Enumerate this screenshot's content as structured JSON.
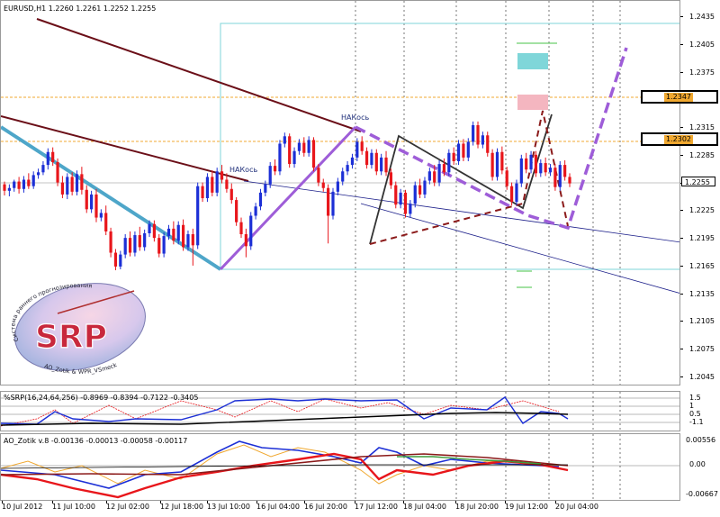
{
  "colors": {
    "bull": "#1c2fd6",
    "bear": "#e8161b",
    "purple": "#9e5dd8",
    "maroon": "#6b0f18",
    "teal": "#4ea6c9",
    "navy": "#1c1f8a",
    "cyan_box": "#7fd6d9",
    "orange_level": "#f0a830"
  },
  "main_chart": {
    "title": "EURUSD,H1  1.2260 1.2261 1.2252 1.2255",
    "price_labels": [
      "1.2435",
      "1.2405",
      "1.2375",
      "1.2345",
      "1.2315",
      "1.2285",
      "1.2255",
      "1.2225",
      "1.2195",
      "1.2165",
      "1.2135",
      "1.2105",
      "1.2075",
      "1.2045"
    ],
    "current_price": "1.2255",
    "level_tags": [
      "1.2347",
      "1.2302"
    ],
    "annotations": [
      "НАКось",
      "НАКось"
    ],
    "logo": {
      "text": "SRP",
      "arc_top": "Система раннего прогнозирования",
      "arc_bottom": "AO_Zotik & WPR_VSmeck"
    },
    "candles": [
      [
        1.2254,
        1.2247,
        1.2257,
        1.2242
      ],
      [
        1.2247,
        1.225,
        1.2254,
        1.2241
      ],
      [
        1.225,
        1.2257,
        1.2259,
        1.2246
      ],
      [
        1.2257,
        1.2249,
        1.2262,
        1.2244
      ],
      [
        1.2249,
        1.2259,
        1.2263,
        1.2245
      ],
      [
        1.2259,
        1.2252,
        1.2266,
        1.2249
      ],
      [
        1.2252,
        1.2264,
        1.2268,
        1.2249
      ],
      [
        1.2264,
        1.2267,
        1.2271,
        1.226
      ],
      [
        1.2267,
        1.2275,
        1.2279,
        1.2264
      ],
      [
        1.2275,
        1.2289,
        1.2293,
        1.227
      ],
      [
        1.2289,
        1.2278,
        1.2294,
        1.2274
      ],
      [
        1.2278,
        1.2256,
        1.2282,
        1.2252
      ],
      [
        1.2256,
        1.2243,
        1.2263,
        1.2239
      ],
      [
        1.2243,
        1.2262,
        1.2266,
        1.2238
      ],
      [
        1.2262,
        1.2246,
        1.2267,
        1.2242
      ],
      [
        1.2246,
        1.2265,
        1.2269,
        1.2242
      ],
      [
        1.2265,
        1.2248,
        1.2273,
        1.2243
      ],
      [
        1.2248,
        1.2227,
        1.2253,
        1.2223
      ],
      [
        1.2227,
        1.2243,
        1.2247,
        1.2223
      ],
      [
        1.2243,
        1.2218,
        1.2249,
        1.2213
      ],
      [
        1.2218,
        1.2223,
        1.2227,
        1.2214
      ],
      [
        1.2223,
        1.2203,
        1.2231,
        1.2199
      ],
      [
        1.2203,
        1.218,
        1.2207,
        1.2175
      ],
      [
        1.218,
        1.2165,
        1.2184,
        1.2161
      ],
      [
        1.2165,
        1.2178,
        1.2182,
        1.2162
      ],
      [
        1.2178,
        1.2196,
        1.22,
        1.2174
      ],
      [
        1.2196,
        1.218,
        1.2203,
        1.2176
      ],
      [
        1.218,
        1.2199,
        1.2203,
        1.2176
      ],
      [
        1.2199,
        1.2186,
        1.2208,
        1.2182
      ],
      [
        1.2186,
        1.2201,
        1.2205,
        1.2182
      ],
      [
        1.2201,
        1.2211,
        1.2215,
        1.2197
      ],
      [
        1.2211,
        1.2196,
        1.2215,
        1.2192
      ],
      [
        1.2196,
        1.2179,
        1.22,
        1.2175
      ],
      [
        1.2179,
        1.2198,
        1.2202,
        1.2175
      ],
      [
        1.2198,
        1.2206,
        1.221,
        1.2194
      ],
      [
        1.2206,
        1.2193,
        1.2214,
        1.2189
      ],
      [
        1.2193,
        1.221,
        1.2214,
        1.2189
      ],
      [
        1.221,
        1.2186,
        1.2216,
        1.2182
      ],
      [
        1.2186,
        1.22,
        1.2204,
        1.2182
      ],
      [
        1.22,
        1.2188,
        1.2206,
        1.2166
      ],
      [
        1.2188,
        1.2252,
        1.2256,
        1.2184
      ],
      [
        1.2252,
        1.2239,
        1.2256,
        1.2235
      ],
      [
        1.2239,
        1.2262,
        1.2266,
        1.2235
      ],
      [
        1.2262,
        1.2245,
        1.2269,
        1.2241
      ],
      [
        1.2245,
        1.2268,
        1.2272,
        1.2241
      ],
      [
        1.2268,
        1.2259,
        1.2275,
        1.2255
      ],
      [
        1.2259,
        1.2249,
        1.2266,
        1.2245
      ],
      [
        1.2249,
        1.2237,
        1.2255,
        1.2233
      ],
      [
        1.2237,
        1.2213,
        1.224,
        1.2209
      ],
      [
        1.2213,
        1.22,
        1.2218,
        1.2196
      ],
      [
        1.22,
        1.2187,
        1.2206,
        1.2175
      ],
      [
        1.2187,
        1.222,
        1.2224,
        1.2183
      ],
      [
        1.222,
        1.223,
        1.2234,
        1.2216
      ],
      [
        1.223,
        1.2245,
        1.2249,
        1.2226
      ],
      [
        1.2245,
        1.2254,
        1.2258,
        1.2241
      ],
      [
        1.2254,
        1.2274,
        1.2278,
        1.225
      ],
      [
        1.2274,
        1.2268,
        1.2281,
        1.2264
      ],
      [
        1.2268,
        1.2298,
        1.2302,
        1.2264
      ],
      [
        1.2298,
        1.2306,
        1.231,
        1.2294
      ],
      [
        1.2306,
        1.2276,
        1.2309,
        1.2272
      ],
      [
        1.2276,
        1.229,
        1.2294,
        1.2272
      ],
      [
        1.229,
        1.2299,
        1.2303,
        1.2286
      ],
      [
        1.2299,
        1.2288,
        1.2305,
        1.2284
      ],
      [
        1.2288,
        1.2302,
        1.2306,
        1.2284
      ],
      [
        1.2302,
        1.2272,
        1.2305,
        1.2268
      ],
      [
        1.2272,
        1.2256,
        1.2276,
        1.2252
      ],
      [
        1.2256,
        1.225,
        1.226,
        1.2246
      ],
      [
        1.225,
        1.222,
        1.2254,
        1.219
      ],
      [
        1.222,
        1.2246,
        1.225,
        1.2216
      ],
      [
        1.2246,
        1.2257,
        1.2261,
        1.2242
      ],
      [
        1.2257,
        1.2268,
        1.2272,
        1.2253
      ],
      [
        1.2268,
        1.2275,
        1.2279,
        1.2264
      ],
      [
        1.2275,
        1.2283,
        1.2287,
        1.2271
      ],
      [
        1.2283,
        1.23,
        1.2304,
        1.2279
      ],
      [
        1.23,
        1.229,
        1.2306,
        1.2286
      ],
      [
        1.229,
        1.2275,
        1.2294,
        1.2271
      ],
      [
        1.2275,
        1.2288,
        1.2292,
        1.2271
      ],
      [
        1.2288,
        1.2268,
        1.2292,
        1.2264
      ],
      [
        1.2268,
        1.2283,
        1.2287,
        1.2264
      ],
      [
        1.2283,
        1.2267,
        1.229,
        1.2263
      ],
      [
        1.2267,
        1.2253,
        1.2271,
        1.2249
      ],
      [
        1.2253,
        1.2232,
        1.2257,
        1.2228
      ],
      [
        1.2232,
        1.2245,
        1.2249,
        1.2228
      ],
      [
        1.2245,
        1.2222,
        1.2248,
        1.2218
      ],
      [
        1.2222,
        1.2233,
        1.2237,
        1.2218
      ],
      [
        1.2233,
        1.2253,
        1.2257,
        1.2229
      ],
      [
        1.2253,
        1.2243,
        1.226,
        1.2239
      ],
      [
        1.2243,
        1.2258,
        1.2262,
        1.2239
      ],
      [
        1.2258,
        1.2268,
        1.2272,
        1.2254
      ],
      [
        1.2268,
        1.2256,
        1.2275,
        1.2252
      ],
      [
        1.2256,
        1.2276,
        1.228,
        1.2252
      ],
      [
        1.2276,
        1.2267,
        1.2282,
        1.2263
      ],
      [
        1.2267,
        1.2288,
        1.2292,
        1.2263
      ],
      [
        1.2288,
        1.2279,
        1.2294,
        1.2275
      ],
      [
        1.2279,
        1.2298,
        1.2302,
        1.2275
      ],
      [
        1.2298,
        1.2283,
        1.2303,
        1.2279
      ],
      [
        1.2283,
        1.23,
        1.2304,
        1.2279
      ],
      [
        1.23,
        1.2318,
        1.2322,
        1.2296
      ],
      [
        1.2318,
        1.2297,
        1.2322,
        1.2293
      ],
      [
        1.2297,
        1.2307,
        1.2311,
        1.2293
      ],
      [
        1.2307,
        1.2288,
        1.2311,
        1.2284
      ],
      [
        1.2288,
        1.2262,
        1.2292,
        1.2258
      ],
      [
        1.2262,
        1.2289,
        1.2293,
        1.2258
      ],
      [
        1.2289,
        1.2269,
        1.2295,
        1.2265
      ],
      [
        1.2269,
        1.2252,
        1.2273,
        1.2248
      ],
      [
        1.2252,
        1.2235,
        1.2256,
        1.2231
      ],
      [
        1.2235,
        1.2255,
        1.2259,
        1.2231
      ],
      [
        1.2255,
        1.2282,
        1.2286,
        1.2251
      ],
      [
        1.2282,
        1.227,
        1.2288,
        1.2266
      ],
      [
        1.227,
        1.2286,
        1.229,
        1.2266
      ],
      [
        1.2286,
        1.2266,
        1.229,
        1.2262
      ],
      [
        1.2266,
        1.2277,
        1.2281,
        1.2262
      ],
      [
        1.2277,
        1.2267,
        1.2283,
        1.2263
      ],
      [
        1.2267,
        1.2272,
        1.2276,
        1.2263
      ],
      [
        1.2272,
        1.2251,
        1.2276,
        1.2247
      ],
      [
        1.2251,
        1.2275,
        1.2279,
        1.2247
      ],
      [
        1.2275,
        1.2262,
        1.228,
        1.2258
      ],
      [
        1.2262,
        1.2255,
        1.2266,
        1.2251
      ]
    ]
  },
  "srp_indicator": {
    "title": "%SRP(16,24,64,256) -0.8969 -0.8394 -0.7122 -0.3405",
    "axis_labels": [
      "1.5",
      "1",
      "0.5",
      "-1.1"
    ]
  },
  "ao_indicator": {
    "title": "AO_Zotik v.8 -0.00136 -0.00013 -0.00058 -0.00117",
    "axis_labels": [
      "0.00556",
      "0.00",
      "-0.00667"
    ]
  },
  "time_axis": {
    "labels": [
      "10 Jul 2012",
      "11 Jul 10:00",
      "12 Jul 02:00",
      "12 Jul 18:00",
      "13 Jul 10:00",
      "16 Jul 04:00",
      "16 Jul 20:00",
      "17 Jul 12:00",
      "18 Jul 04:00",
      "18 Jul 20:00",
      "19 Jul 12:00",
      "20 Jul 04:00"
    ]
  }
}
